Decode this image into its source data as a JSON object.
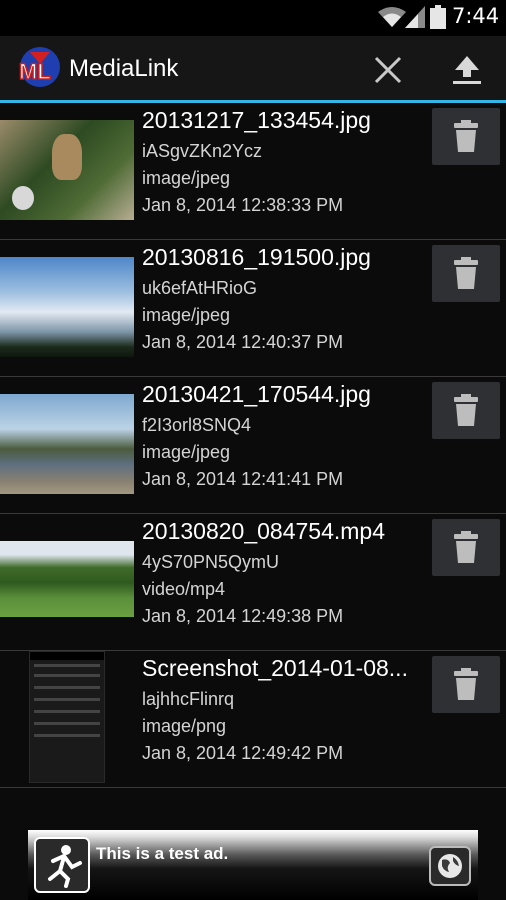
{
  "status_bar": {
    "time": "7:44",
    "icons": [
      "wifi-icon",
      "signal-icon",
      "battery-icon"
    ]
  },
  "action_bar": {
    "title": "MediaLink",
    "logo_text": "ML",
    "actions": [
      "close-icon",
      "upload-icon"
    ]
  },
  "colors": {
    "accent": "#33b5e5",
    "delete_button": "#2e3033",
    "background": "#0b0b0b"
  },
  "files": [
    {
      "name": "20131217_133454.jpg",
      "id": "iASgvZKn2Ycz",
      "mime": "image/jpeg",
      "date": "Jan 8, 2014 12:38:33 PM"
    },
    {
      "name": "20130816_191500.jpg",
      "id": "uk6efAtHRioG",
      "mime": "image/jpeg",
      "date": "Jan 8, 2014 12:40:37 PM"
    },
    {
      "name": "20130421_170544.jpg",
      "id": "f2I3orl8SNQ4",
      "mime": "image/jpeg",
      "date": "Jan 8, 2014 12:41:41 PM"
    },
    {
      "name": "20130820_084754.mp4",
      "id": "4yS70PN5QymU",
      "mime": "video/mp4",
      "date": "Jan 8, 2014 12:49:38 PM"
    },
    {
      "name": "Screenshot_2014-01-08...",
      "id": "lajhhcFlinrq",
      "mime": "image/png",
      "date": "Jan 8, 2014 12:49:42 PM"
    }
  ],
  "ad": {
    "text": "This is a test ad."
  }
}
